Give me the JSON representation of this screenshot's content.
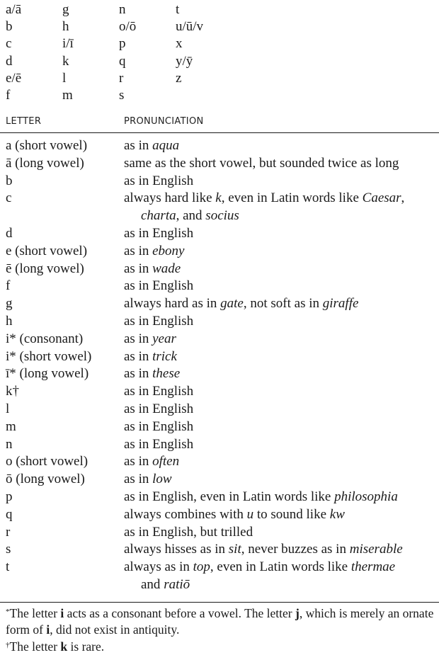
{
  "alphabet": {
    "columns": [
      [
        "a/ā",
        "b",
        "c",
        "d",
        "e/ē",
        "f"
      ],
      [
        "g",
        "h",
        "i/ī",
        "k",
        "l",
        "m"
      ],
      [
        "n",
        "o/ō",
        "p",
        "q",
        "r",
        "s"
      ],
      [
        "t",
        "u/ū/v",
        "x",
        "y/ȳ",
        "z"
      ]
    ]
  },
  "table": {
    "headers": {
      "letter": "LETTER",
      "pronunciation": "PRONUNCIATION"
    },
    "rows": [
      {
        "letter": "a (short vowel)",
        "pron": [
          [
            "as in ",
            ""
          ],
          [
            "aqua",
            "i"
          ]
        ]
      },
      {
        "letter": "ā (long vowel)",
        "pron": [
          [
            "same as the short vowel, but sounded twice as long",
            ""
          ]
        ]
      },
      {
        "letter": "b",
        "pron": [
          [
            "as in English",
            ""
          ]
        ]
      },
      {
        "letter": "c",
        "pron": [
          [
            "always hard like ",
            ""
          ],
          [
            "k",
            "i"
          ],
          [
            ", even in Latin words like ",
            ""
          ],
          [
            "Caesar",
            "i"
          ],
          [
            ",",
            ""
          ]
        ],
        "cont": [
          [
            "charta",
            "i"
          ],
          [
            ", and ",
            ""
          ],
          [
            "socius",
            "i"
          ]
        ]
      },
      {
        "letter": "d",
        "pron": [
          [
            "as in English",
            ""
          ]
        ]
      },
      {
        "letter": "e (short vowel)",
        "pron": [
          [
            "as in ",
            ""
          ],
          [
            "ebony",
            "i"
          ]
        ]
      },
      {
        "letter": "ē (long vowel)",
        "pron": [
          [
            "as in ",
            ""
          ],
          [
            "wade",
            "i"
          ]
        ]
      },
      {
        "letter": "f",
        "pron": [
          [
            "as in English",
            ""
          ]
        ]
      },
      {
        "letter": "g",
        "pron": [
          [
            "always hard as in ",
            ""
          ],
          [
            "gate",
            "i"
          ],
          [
            ", not soft as in ",
            ""
          ],
          [
            "giraffe",
            "i"
          ]
        ]
      },
      {
        "letter": "h",
        "pron": [
          [
            "as in English",
            ""
          ]
        ]
      },
      {
        "letter": "i* (consonant)",
        "pron": [
          [
            "as in ",
            ""
          ],
          [
            "year",
            "i"
          ]
        ]
      },
      {
        "letter": "i* (short vowel)",
        "pron": [
          [
            "as in ",
            ""
          ],
          [
            "trick",
            "i"
          ]
        ]
      },
      {
        "letter": "ī* (long vowel)",
        "pron": [
          [
            "as in ",
            ""
          ],
          [
            "these",
            "i"
          ]
        ]
      },
      {
        "letter": "k†",
        "pron": [
          [
            "as in English",
            ""
          ]
        ]
      },
      {
        "letter": "l",
        "pron": [
          [
            "as in English",
            ""
          ]
        ]
      },
      {
        "letter": "m",
        "pron": [
          [
            "as in English",
            ""
          ]
        ]
      },
      {
        "letter": "n",
        "pron": [
          [
            "as in English",
            ""
          ]
        ]
      },
      {
        "letter": "o (short vowel)",
        "pron": [
          [
            "as in ",
            ""
          ],
          [
            "often",
            "i"
          ]
        ]
      },
      {
        "letter": "ō (long vowel)",
        "pron": [
          [
            "as in ",
            ""
          ],
          [
            "low",
            "i"
          ]
        ]
      },
      {
        "letter": "p",
        "pron": [
          [
            "as in English, even in Latin words like ",
            ""
          ],
          [
            "philosophia",
            "i"
          ]
        ]
      },
      {
        "letter": "q",
        "pron": [
          [
            "always combines with ",
            ""
          ],
          [
            "u",
            "i"
          ],
          [
            " to sound like ",
            ""
          ],
          [
            "kw",
            "i"
          ]
        ]
      },
      {
        "letter": "r",
        "pron": [
          [
            "as in English, but trilled",
            ""
          ]
        ]
      },
      {
        "letter": "s",
        "pron": [
          [
            "always hisses as in ",
            ""
          ],
          [
            "sit",
            "i"
          ],
          [
            ", never buzzes as in ",
            ""
          ],
          [
            "miserable",
            "i"
          ]
        ]
      },
      {
        "letter": "t",
        "pron": [
          [
            "always as in ",
            ""
          ],
          [
            "top",
            "i"
          ],
          [
            ", even in Latin words like ",
            ""
          ],
          [
            "thermae",
            "i"
          ]
        ],
        "cont": [
          [
            "and ",
            ""
          ],
          [
            "ratiō",
            "i"
          ]
        ]
      }
    ]
  },
  "footnotes": [
    {
      "marker": "*",
      "parts": [
        [
          "The letter ",
          ""
        ],
        [
          "i",
          "b"
        ],
        [
          " acts as a consonant before a vowel. The letter ",
          ""
        ],
        [
          "j",
          "b"
        ],
        [
          ", which is merely an ornate form of ",
          ""
        ],
        [
          "i",
          "b"
        ],
        [
          ", did not exist in antiquity.",
          ""
        ]
      ]
    },
    {
      "marker": "†",
      "parts": [
        [
          "The letter ",
          ""
        ],
        [
          "k",
          "b"
        ],
        [
          " is rare.",
          ""
        ]
      ]
    }
  ]
}
